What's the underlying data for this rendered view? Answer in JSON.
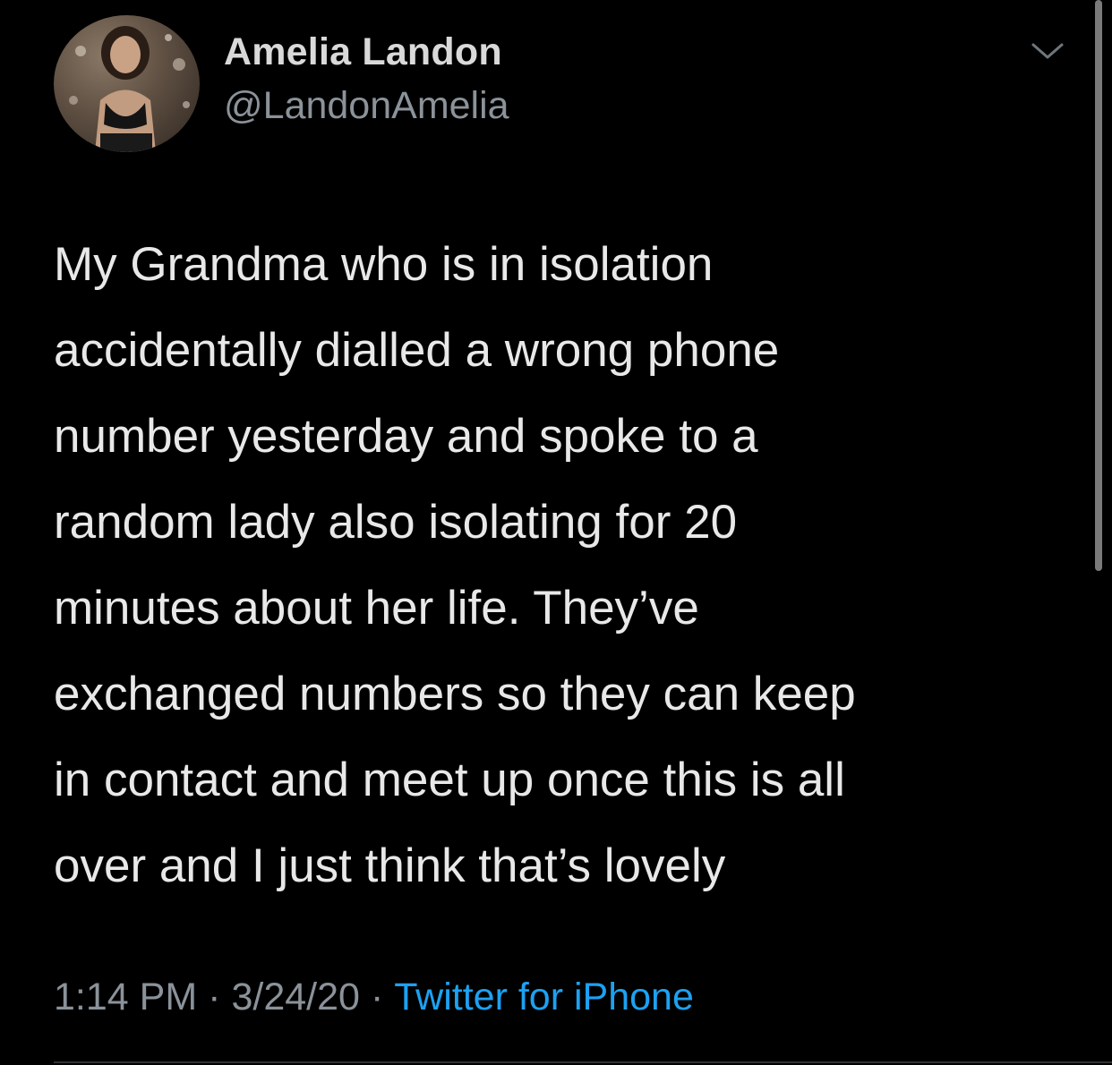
{
  "user": {
    "display_name": "Amelia Landon",
    "handle": "@LandonAmelia"
  },
  "tweet": {
    "text": "My Grandma who is in isolation\naccidentally dialled a wrong phone\nnumber yesterday and spoke to a\nrandom lady also isolating for 20\nminutes about her life. They’ve\nexchanged numbers so they can keep\nin contact and meet up once this is all\nover and I just think that’s lovely",
    "time": "1:14 PM",
    "date": "3/24/20",
    "separator": "·",
    "source": "Twitter for iPhone"
  },
  "icons": {
    "menu": "chevron-down-icon",
    "avatar": "profile-photo"
  },
  "colors": {
    "background": "#000000",
    "name": "#d9d9d9",
    "text": "#e8e8e8",
    "muted": "#8b9299",
    "link": "#1da1f2",
    "divider": "#2f3336"
  },
  "scrollbar": {
    "visible_fraction": 0.54
  }
}
